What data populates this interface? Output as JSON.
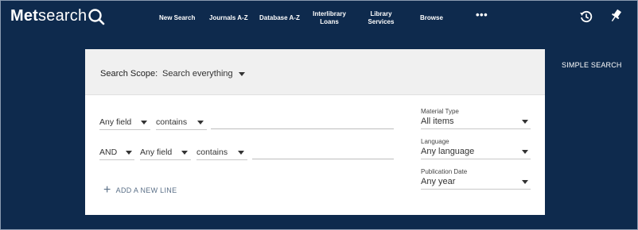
{
  "logo": {
    "part1": "Met",
    "part2": "search"
  },
  "nav": {
    "new_search": "New Search",
    "journals": "Journals A-Z",
    "database": "Database A-Z",
    "interlibrary": "Interlibrary Loans",
    "library_services": "Library Services",
    "browse": "Browse",
    "more": "•••"
  },
  "icons": {
    "history": "history-icon",
    "pin": "pin-icon",
    "magnifier": "search-icon"
  },
  "colors": {
    "background": "#0e2a4d",
    "panel": "#ffffff",
    "scope_bar": "#f0f0f0"
  },
  "scope": {
    "label": "Search Scope:",
    "value": "Search everything"
  },
  "rows": [
    {
      "field": "Any field",
      "operator": "contains"
    },
    {
      "boolean": "AND",
      "field": "Any field",
      "operator": "contains"
    }
  ],
  "add_line": "ADD A NEW LINE",
  "filters": {
    "material_type": {
      "label": "Material Type",
      "value": "All items"
    },
    "language": {
      "label": "Language",
      "value": "Any language"
    },
    "publication_date": {
      "label": "Publication Date",
      "value": "Any year"
    }
  },
  "simple_search": "SIMPLE SEARCH"
}
